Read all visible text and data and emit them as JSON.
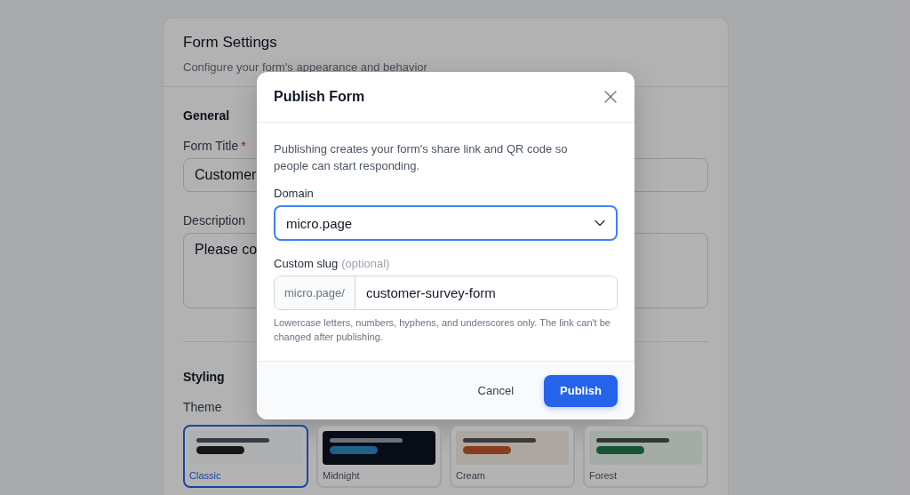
{
  "settings": {
    "title": "Form Settings",
    "subtitle": "Configure your form's appearance and behavior",
    "general": {
      "heading": "General",
      "title_label": "Form Title",
      "required_mark": "*",
      "title_value": "Customer",
      "description_label": "Description",
      "description_value": "Please co"
    },
    "styling": {
      "heading": "Styling",
      "theme_label": "Theme",
      "themes": [
        {
          "name": "Classic",
          "selected": true,
          "swatches": [
            {
              "kind": "background",
              "color": "#aeafb0"
            },
            {
              "kind": "line",
              "color": "#353c45"
            },
            {
              "kind": "accent",
              "color": "#161617"
            }
          ]
        },
        {
          "name": "Midnight",
          "selected": false,
          "swatches": [
            {
              "kind": "background",
              "color": "#080c16"
            },
            {
              "kind": "line",
              "color": "#6d727a"
            },
            {
              "kind": "accent",
              "color": "#1e6289"
            }
          ]
        },
        {
          "name": "Cream",
          "selected": false,
          "swatches": [
            {
              "kind": "background",
              "color": "#ada7a1"
            },
            {
              "kind": "line",
              "color": "#3d3a37"
            },
            {
              "kind": "accent",
              "color": "#883e1e"
            }
          ]
        },
        {
          "name": "Forest",
          "selected": false,
          "swatches": [
            {
              "kind": "background",
              "color": "#a5aca7"
            },
            {
              "kind": "line",
              "color": "#2c3c30"
            },
            {
              "kind": "accent",
              "color": "#175534"
            }
          ]
        }
      ]
    }
  },
  "dialog": {
    "title": "Publish Form",
    "intro": "Publishing creates your form's share link and QR code so people can start responding.",
    "domain": {
      "label": "Domain",
      "value": "micro.page",
      "focused": true
    },
    "slug": {
      "label": "Custom slug",
      "hint": "(optional)",
      "prefix": "micro.page/",
      "value": "customer-survey-form",
      "help": "Lowercase letters, numbers, hyphens, and underscores only. The link can't be changed after publishing."
    },
    "buttons": [
      {
        "label": "Cancel",
        "kind": "secondary"
      },
      {
        "label": "Publish",
        "kind": "primary"
      }
    ]
  }
}
